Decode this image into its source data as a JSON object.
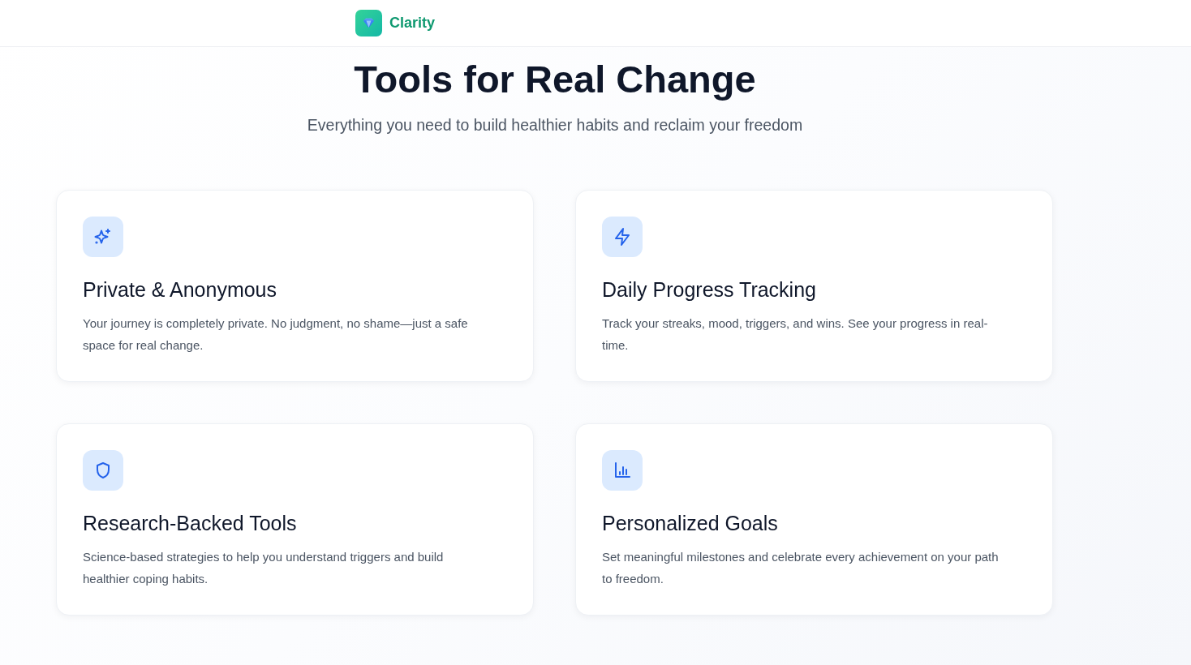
{
  "header": {
    "brand": "Clarity"
  },
  "hero": {
    "title": "Tools for Real Change",
    "subtitle": "Everything you need to build healthier habits and reclaim your freedom"
  },
  "features": [
    {
      "kind": "sparkles",
      "title": "Private & Anonymous",
      "description": "Your journey is completely private. No judgment, no shame—just a safe space for real change."
    },
    {
      "kind": "bolt",
      "title": "Daily Progress Tracking",
      "description": "Track your streaks, mood, triggers, and wins. See your progress in real-time."
    },
    {
      "kind": "shield",
      "title": "Research-Backed Tools",
      "description": "Science-based strategies to help you understand triggers and build healthier coping habits."
    },
    {
      "kind": "chart",
      "title": "Personalized Goals",
      "description": "Set meaningful milestones and celebrate every achievement on your path to freedom."
    }
  ]
}
